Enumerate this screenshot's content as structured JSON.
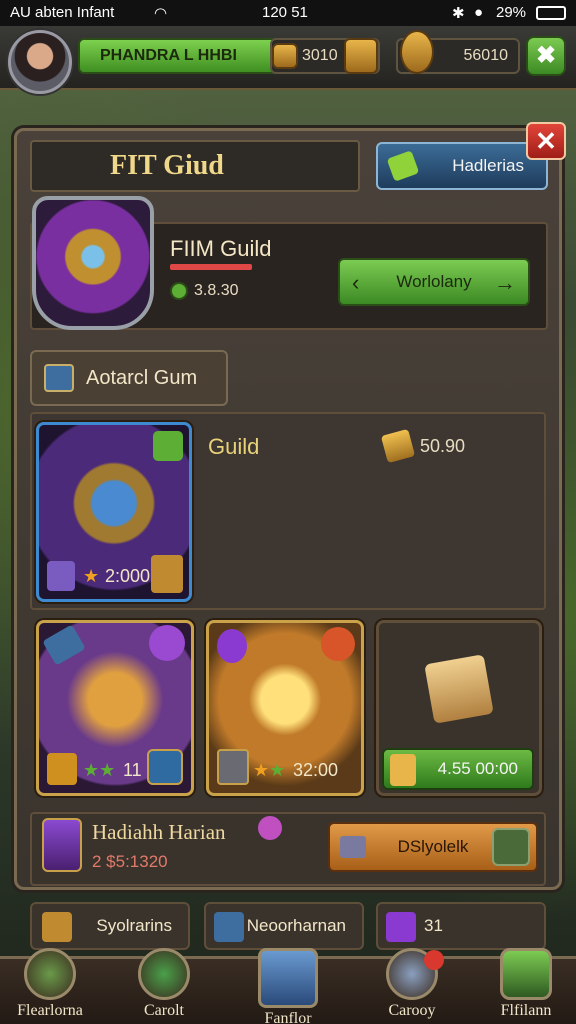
{
  "status_bar": {
    "carrier": "AU abten Infant",
    "time": "120 51",
    "battery": "29%"
  },
  "hud": {
    "player_name": "PHANDRA L HHBI",
    "currency1": "3010",
    "currency2": "56010"
  },
  "panel": {
    "title": "FIT Giud",
    "header_button": "Hadlerias",
    "guild_name": "FIIM Guild",
    "guild_value": "3.8.30",
    "green_button": "Worlolany",
    "tab_button": "Aotarcl Gum",
    "guild_label": "Guild",
    "gold_amount": "50.90",
    "main_card_stat": "2:000",
    "card_a_stat": "11",
    "card_b_stat": "32:00",
    "card_c_price": "4.55 00:00",
    "hero_name": "Hadiahh Harian",
    "hero_value": "2 $5:1320",
    "orange_button": "DSlyolelk"
  },
  "ribbon": [
    {
      "label": "Syolrarins"
    },
    {
      "label": "Neoorharnan"
    },
    {
      "label": "31"
    }
  ],
  "nav": [
    {
      "label": "Flearlorna"
    },
    {
      "label": "Carolt"
    },
    {
      "label": "Fanflor"
    },
    {
      "label": "Carooy"
    },
    {
      "label": "Flfilann"
    }
  ],
  "colors": {
    "accent_green": "#5cae35",
    "accent_gold": "#e0b04a",
    "close_red": "#d9382e",
    "blue_button": "#2f5a84"
  }
}
